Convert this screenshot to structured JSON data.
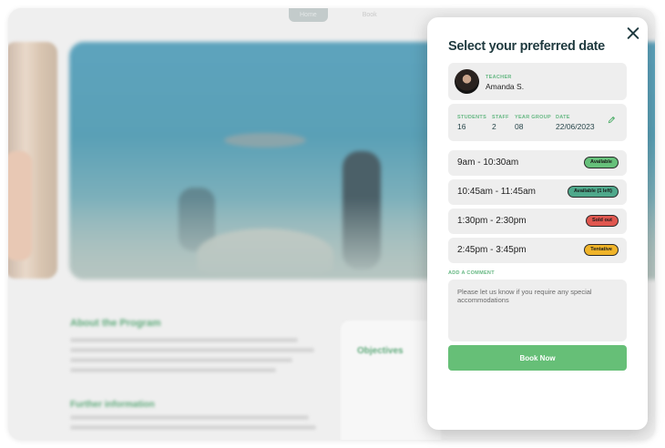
{
  "background": {
    "tabs": [
      "Home",
      "Book"
    ],
    "about_title": "About the Program",
    "further_title": "Further information",
    "objectives_title": "Objectives"
  },
  "modal": {
    "title": "Select your preferred date",
    "teacher": {
      "label": "TEACHER",
      "name": "Amanda S."
    },
    "stats": [
      {
        "label": "STUDENTS",
        "value": "16"
      },
      {
        "label": "STAFF",
        "value": "2"
      },
      {
        "label": "YEAR GROUP",
        "value": "08"
      },
      {
        "label": "DATE",
        "value": "22/06/2023"
      }
    ],
    "slots": [
      {
        "time": "9am - 10:30am",
        "status": "Available",
        "color": "#66c07a"
      },
      {
        "time": "10:45am - 11:45am",
        "status": "Available (1 left)",
        "color": "#4fa88b"
      },
      {
        "time": "1:30pm - 2:30pm",
        "status": "Sold out",
        "color": "#e0574f"
      },
      {
        "time": "2:45pm - 3:45pm",
        "status": "Tentative",
        "color": "#f0b429"
      }
    ],
    "comment": {
      "label": "ADD A COMMENT",
      "placeholder": "Please let us know if you require any special accommodations"
    },
    "book_label": "Book Now"
  },
  "icons": [
    "close-icon",
    "pencil-icon",
    "avatar"
  ]
}
